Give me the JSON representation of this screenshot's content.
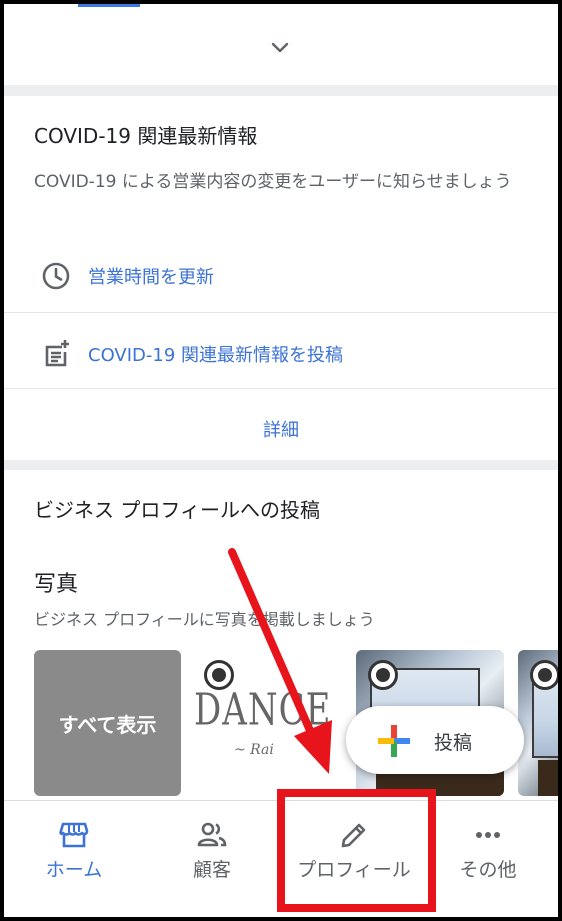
{
  "covid": {
    "title": "COVID-19 関連最新情報",
    "description": "COVID-19 による営業内容の変更をユーザーに知らせましょう",
    "actions": [
      {
        "label": "営業時間を更新",
        "icon": "clock-icon"
      },
      {
        "label": "COVID-19 関連最新情報を投稿",
        "icon": "post-add-icon"
      }
    ],
    "details_label": "詳細"
  },
  "posts": {
    "title": "ビジネス プロフィールへの投稿",
    "photos_title": "写真",
    "photos_description": "ビジネス プロフィールに写真を掲載しましょう",
    "show_all_label": "すべて表示",
    "logo_text": "DANCE",
    "logo_subtext": "~ Rai"
  },
  "fab": {
    "label": "投稿",
    "colors": [
      "#ea4335",
      "#fbbc05",
      "#34a853",
      "#4285f4"
    ]
  },
  "bottom_nav": {
    "items": [
      {
        "label": "ホーム",
        "icon": "store-icon",
        "active": true
      },
      {
        "label": "顧客",
        "icon": "people-icon",
        "active": false
      },
      {
        "label": "プロフィール",
        "icon": "pencil-icon",
        "active": false
      },
      {
        "label": "その他",
        "icon": "more-horiz-icon",
        "active": false
      }
    ]
  },
  "annotation": {
    "color": "#e8141b",
    "target": "bottom_nav.items.2"
  },
  "theme": {
    "accent": "#3c73d6",
    "background": "#eceef0"
  }
}
